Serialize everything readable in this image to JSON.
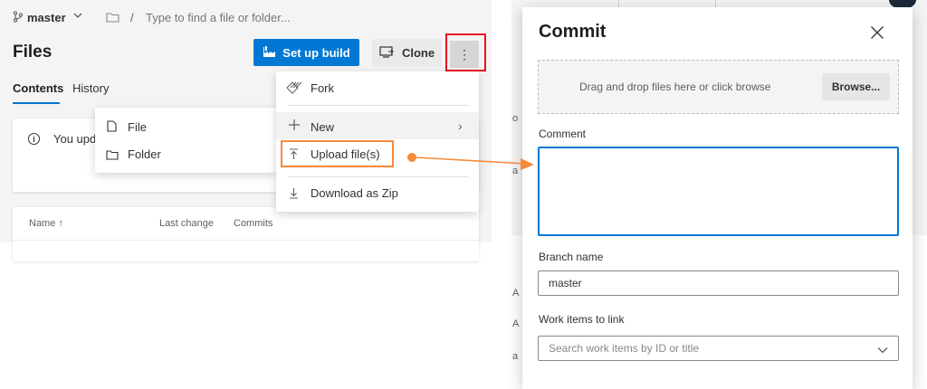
{
  "repo_header": {
    "branch": "master",
    "path_placeholder": "Type to find a file or folder...",
    "path_separator": "/",
    "page_title": "Files"
  },
  "toolbar": {
    "setup_build_label": "Set up build",
    "clone_label": "Clone",
    "more_label": "⋮"
  },
  "tabs": [
    {
      "label": "Contents",
      "selected": true
    },
    {
      "label": "History",
      "selected": false
    }
  ],
  "info_banner": {
    "text": "You upd"
  },
  "file_table": {
    "columns": [
      "Name ↑",
      "Last change",
      "Commits"
    ]
  },
  "more_menu": {
    "items": [
      {
        "label": "Fork",
        "icon": "fork-icon"
      },
      {
        "label": "New",
        "icon": "plus-icon",
        "has_submenu": true,
        "chevron": "›"
      },
      {
        "label": "Upload file(s)",
        "icon": "upload-icon",
        "highlighted": true
      },
      {
        "label": "Download as Zip",
        "icon": "download-icon"
      }
    ]
  },
  "new_submenu": {
    "items": [
      {
        "label": "File",
        "icon": "file-icon"
      },
      {
        "label": "Folder",
        "icon": "folder-icon"
      }
    ]
  },
  "commit_dialog": {
    "title": "Commit",
    "dropzone_text": "Drag and drop files here or click browse",
    "browse_label": "Browse...",
    "comment_label": "Comment",
    "comment_value": "",
    "branch_label": "Branch name",
    "branch_value": "master",
    "work_items_label": "Work items to link",
    "work_items_placeholder": "Search work items by ID or title"
  },
  "background_glimpses": {
    "items": [
      "o",
      "a",
      "A",
      "A",
      "a"
    ]
  },
  "colors": {
    "primary": "#0078d4",
    "highlight_red": "#e81123",
    "callout_orange": "#f7893b",
    "menu_hover": "#f3f2f1"
  }
}
